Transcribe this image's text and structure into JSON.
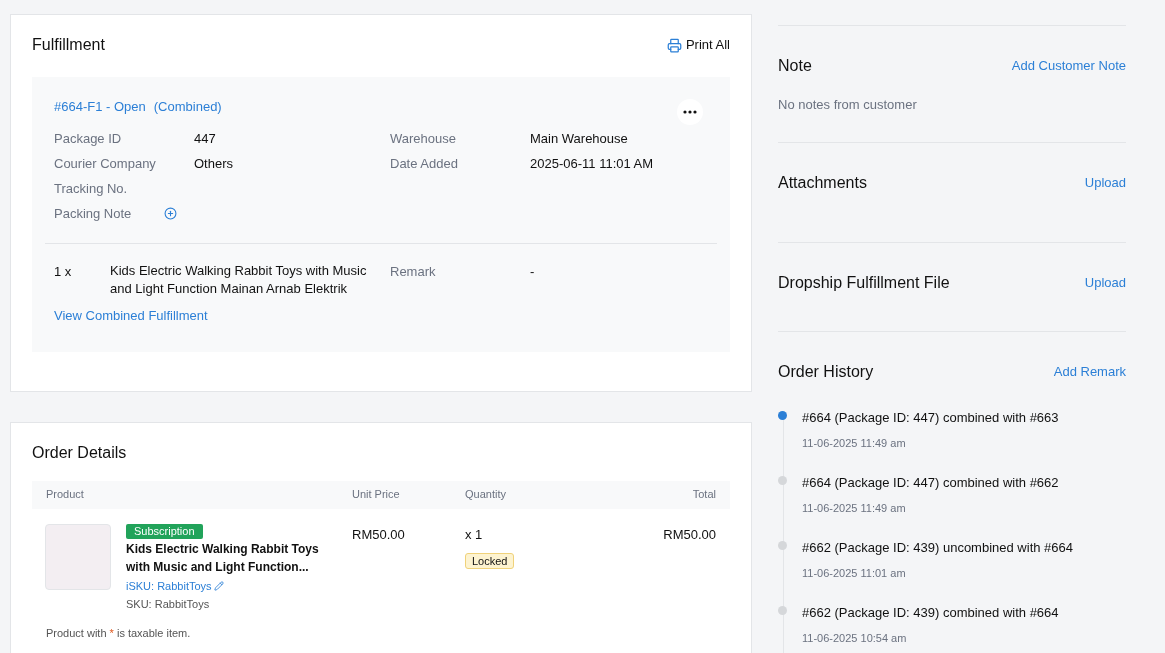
{
  "fulfillment": {
    "title": "Fulfillment",
    "print_all": "Print All",
    "package": {
      "heading": "#664-F1 - Open",
      "tag": "(Combined)",
      "fields_left": [
        {
          "label": "Package ID",
          "value": "447"
        },
        {
          "label": "Courier Company",
          "value": "Others"
        },
        {
          "label": "Tracking No."
        }
      ],
      "packing_note_label": "Packing Note",
      "fields_right": [
        {
          "label": "Warehouse",
          "value": "Main Warehouse"
        },
        {
          "label": "Date Added",
          "value": "2025-06-11 11:01 AM"
        }
      ],
      "item": {
        "qty": "1 x",
        "name": "Kids Electric Walking Rabbit Toys with Music and Light Function Mainan Arnab Elektrik",
        "remark_label": "Remark",
        "remark": "-"
      },
      "view_link": "View Combined Fulfillment"
    }
  },
  "order_details": {
    "title": "Order Details",
    "columns": [
      "Product",
      "Unit Price",
      "Quantity",
      "Total"
    ],
    "rows": [
      {
        "badge": "Subscription",
        "name": "Kids Electric Walking Rabbit Toys with Music and Light Function...",
        "isku": "iSKU: RabbitToys",
        "sku": "SKU: RabbitToys",
        "unit_price": "RM50.00",
        "quantity": "x 1",
        "status": "Locked",
        "total": "RM50.00"
      }
    ],
    "note": {
      "before": "Product with",
      "mark": "*",
      "after": "is taxable item."
    }
  },
  "note": {
    "title": "Note",
    "action": "Add Customer Note",
    "text": "No notes from customer"
  },
  "attachments": {
    "title": "Attachments",
    "action": "Upload"
  },
  "dropship": {
    "title": "Dropship Fulfillment File",
    "action": "Upload"
  },
  "history": {
    "title": "Order History",
    "action": "Add Remark",
    "entries": [
      {
        "text": "#664 (Package ID: 447) combined with #663",
        "time": "11-06-2025 11:49 am",
        "current": true
      },
      {
        "text": "#664 (Package ID: 447) combined with #662",
        "time": "11-06-2025 11:49 am",
        "current": false
      },
      {
        "text": "#662 (Package ID: 439) uncombined with #664",
        "time": "11-06-2025 11:01 am",
        "current": false
      },
      {
        "text": "#662 (Package ID: 439) combined with #664",
        "time": "11-06-2025 10:54 am",
        "current": false
      }
    ]
  }
}
